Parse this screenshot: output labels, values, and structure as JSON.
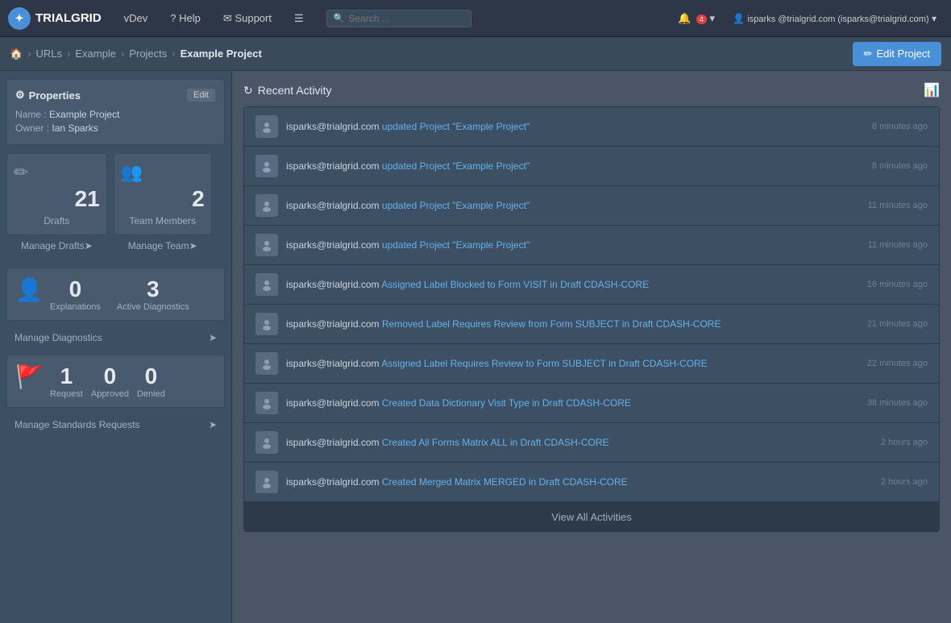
{
  "brand": {
    "name": "TRIALGRID",
    "icon": "TG"
  },
  "navbar": {
    "items": [
      {
        "id": "vdev",
        "label": "vDev"
      },
      {
        "id": "help",
        "label": "Help",
        "icon": "?"
      },
      {
        "id": "support",
        "label": "Support",
        "icon": "💬"
      },
      {
        "id": "menu",
        "label": "☰"
      }
    ],
    "search_placeholder": "Search ...",
    "bell_label": "🔔",
    "notification_count": "4",
    "user_label": "isparks @trialgrid.com (isparks@trialgrid.com)"
  },
  "breadcrumb": {
    "items": [
      {
        "id": "home",
        "label": "🏠"
      },
      {
        "id": "urls",
        "label": "URLs"
      },
      {
        "id": "example",
        "label": "Example"
      },
      {
        "id": "projects",
        "label": "Projects"
      }
    ],
    "current": "Example Project",
    "edit_button": "Edit Project"
  },
  "sidebar": {
    "properties": {
      "title": "Properties",
      "edit_btn": "Edit",
      "name_label": "Name",
      "name_value": "Example Project",
      "owner_label": "Owner",
      "owner_value": "Ian Sparks"
    },
    "drafts": {
      "count": "21",
      "label": "Drafts",
      "manage_label": "Manage Drafts"
    },
    "team": {
      "count": "2",
      "label": "Team Members",
      "manage_label": "Manage Team"
    },
    "diagnostics": {
      "explanations_count": "0",
      "active_count": "3",
      "explanations_label": "Explanations",
      "active_label": "Active Diagnostics",
      "manage_label": "Manage Diagnostics"
    },
    "standards": {
      "request_count": "1",
      "approved_count": "0",
      "denied_count": "0",
      "request_label": "Request",
      "approved_label": "Approved",
      "denied_label": "Denied",
      "manage_label": "Manage Standards Requests"
    }
  },
  "activity": {
    "section_title": "Recent Activity",
    "view_all_label": "View All Activities",
    "rows": [
      {
        "actor": "isparks@trialgrid.com",
        "action": "updated Project \"Example Project\"",
        "time": "8 minutes ago"
      },
      {
        "actor": "isparks@trialgrid.com",
        "action": "updated Project \"Example Project\"",
        "time": "8 minutes ago"
      },
      {
        "actor": "isparks@trialgrid.com",
        "action": "updated Project \"Example Project\"",
        "time": "11 minutes ago"
      },
      {
        "actor": "isparks@trialgrid.com",
        "action": "updated Project \"Example Project\"",
        "time": "11 minutes ago"
      },
      {
        "actor": "isparks@trialgrid.com",
        "action": "Assigned Label Blocked to Form VISIT in Draft CDASH-CORE",
        "time": "16 minutes ago"
      },
      {
        "actor": "isparks@trialgrid.com",
        "action": "Removed Label Requires Review from Form SUBJECT in Draft CDASH-CORE",
        "time": "21 minutes ago"
      },
      {
        "actor": "isparks@trialgrid.com",
        "action": "Assigned Label Requires Review to Form SUBJECT in Draft CDASH-CORE",
        "time": "22 minutes ago"
      },
      {
        "actor": "isparks@trialgrid.com",
        "action": "Created Data Dictionary Visit Type in Draft CDASH-CORE",
        "time": "38 minutes ago"
      },
      {
        "actor": "isparks@trialgrid.com",
        "action": "Created All Forms Matrix ALL in Draft CDASH-CORE",
        "time": "2 hours ago"
      },
      {
        "actor": "isparks@trialgrid.com",
        "action": "Created Merged Matrix MERGED in Draft CDASH-CORE",
        "time": "2 hours ago"
      }
    ]
  }
}
